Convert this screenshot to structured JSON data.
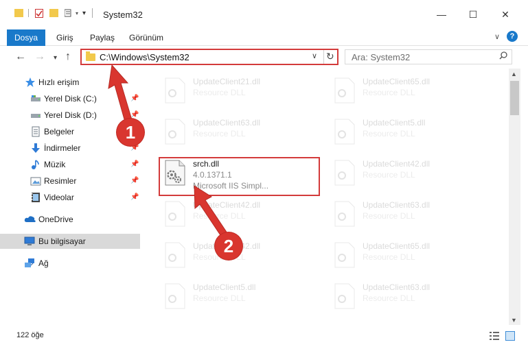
{
  "window": {
    "title": "System32",
    "minimize_glyph": "—",
    "maximize_glyph": "☐",
    "close_glyph": "✕"
  },
  "ribbon": {
    "tabs": [
      {
        "label": "Dosya",
        "active": true
      },
      {
        "label": "Giriş"
      },
      {
        "label": "Paylaş"
      },
      {
        "label": "Görünüm"
      }
    ],
    "collapse_glyph": "∨",
    "help_glyph": "?"
  },
  "nav": {
    "back_glyph": "←",
    "forward_glyph": "→",
    "recent_glyph": "▾",
    "up_glyph": "↑",
    "address_value": "C:\\Windows\\System32",
    "address_dropdown_glyph": "∨",
    "refresh_glyph": "↻",
    "search_placeholder": "Ara: System32",
    "search_glyph": "⚲"
  },
  "sidebar": {
    "items": [
      {
        "label": "Hızlı erişim",
        "icon": "star-icon",
        "pinned": false
      },
      {
        "label": "Yerel Disk (C:)",
        "icon": "drive-icon",
        "pinned": true
      },
      {
        "label": "Yerel Disk (D:)",
        "icon": "drive-icon",
        "pinned": true
      },
      {
        "label": "Belgeler",
        "icon": "documents-icon",
        "pinned": true
      },
      {
        "label": "İndirmeler",
        "icon": "download-icon",
        "pinned": true
      },
      {
        "label": "Müzik",
        "icon": "music-icon",
        "pinned": true
      },
      {
        "label": "Resimler",
        "icon": "pictures-icon",
        "pinned": true
      },
      {
        "label": "Videolar",
        "icon": "video-icon",
        "pinned": true
      },
      {
        "label": "OneDrive",
        "icon": "cloud-icon",
        "pinned": false
      },
      {
        "label": "Bu bilgisayar",
        "icon": "computer-icon",
        "pinned": false,
        "selected": true
      },
      {
        "label": "Ağ",
        "icon": "network-icon",
        "pinned": false
      }
    ],
    "pin_glyph": "📌"
  },
  "files": [
    {
      "name": "UpdateClient21.dll",
      "sub1": "Resource DLL",
      "sub2": ""
    },
    {
      "name": "UpdateClient65.dll",
      "sub1": "Resource DLL",
      "sub2": ""
    },
    {
      "name": "UpdateClient63.dll",
      "sub1": "Resource DLL",
      "sub2": ""
    },
    {
      "name": "UpdateClient5.dll",
      "sub1": "Resource DLL",
      "sub2": ""
    },
    {
      "name": "srch.dll",
      "sub1": "4.0.1371.1",
      "sub2": "Microsoft IIS Simpl...",
      "highlight": true
    },
    {
      "name": "UpdateClient42.dll",
      "sub1": "Resource DLL",
      "sub2": ""
    },
    {
      "name": "UpdateClient42.dll",
      "sub1": "Resource DLL",
      "sub2": ""
    },
    {
      "name": "UpdateClient63.dll",
      "sub1": "Resource DLL",
      "sub2": ""
    },
    {
      "name": "UpdateClient42.dll",
      "sub1": "Resource DLL",
      "sub2": ""
    },
    {
      "name": "UpdateClient65.dll",
      "sub1": "Resource DLL",
      "sub2": ""
    },
    {
      "name": "UpdateClient5.dll",
      "sub1": "Resource DLL",
      "sub2": ""
    },
    {
      "name": "UpdateClient63.dll",
      "sub1": "Resource DLL",
      "sub2": ""
    }
  ],
  "status": {
    "item_count": "122 öğe"
  },
  "annotations": {
    "badge_1": "1",
    "badge_2": "2"
  },
  "colors": {
    "accent": "#1979ca",
    "highlight_red": "#d33a3a",
    "badge_red": "#d9362f",
    "folder_yellow": "#f2c94c"
  }
}
